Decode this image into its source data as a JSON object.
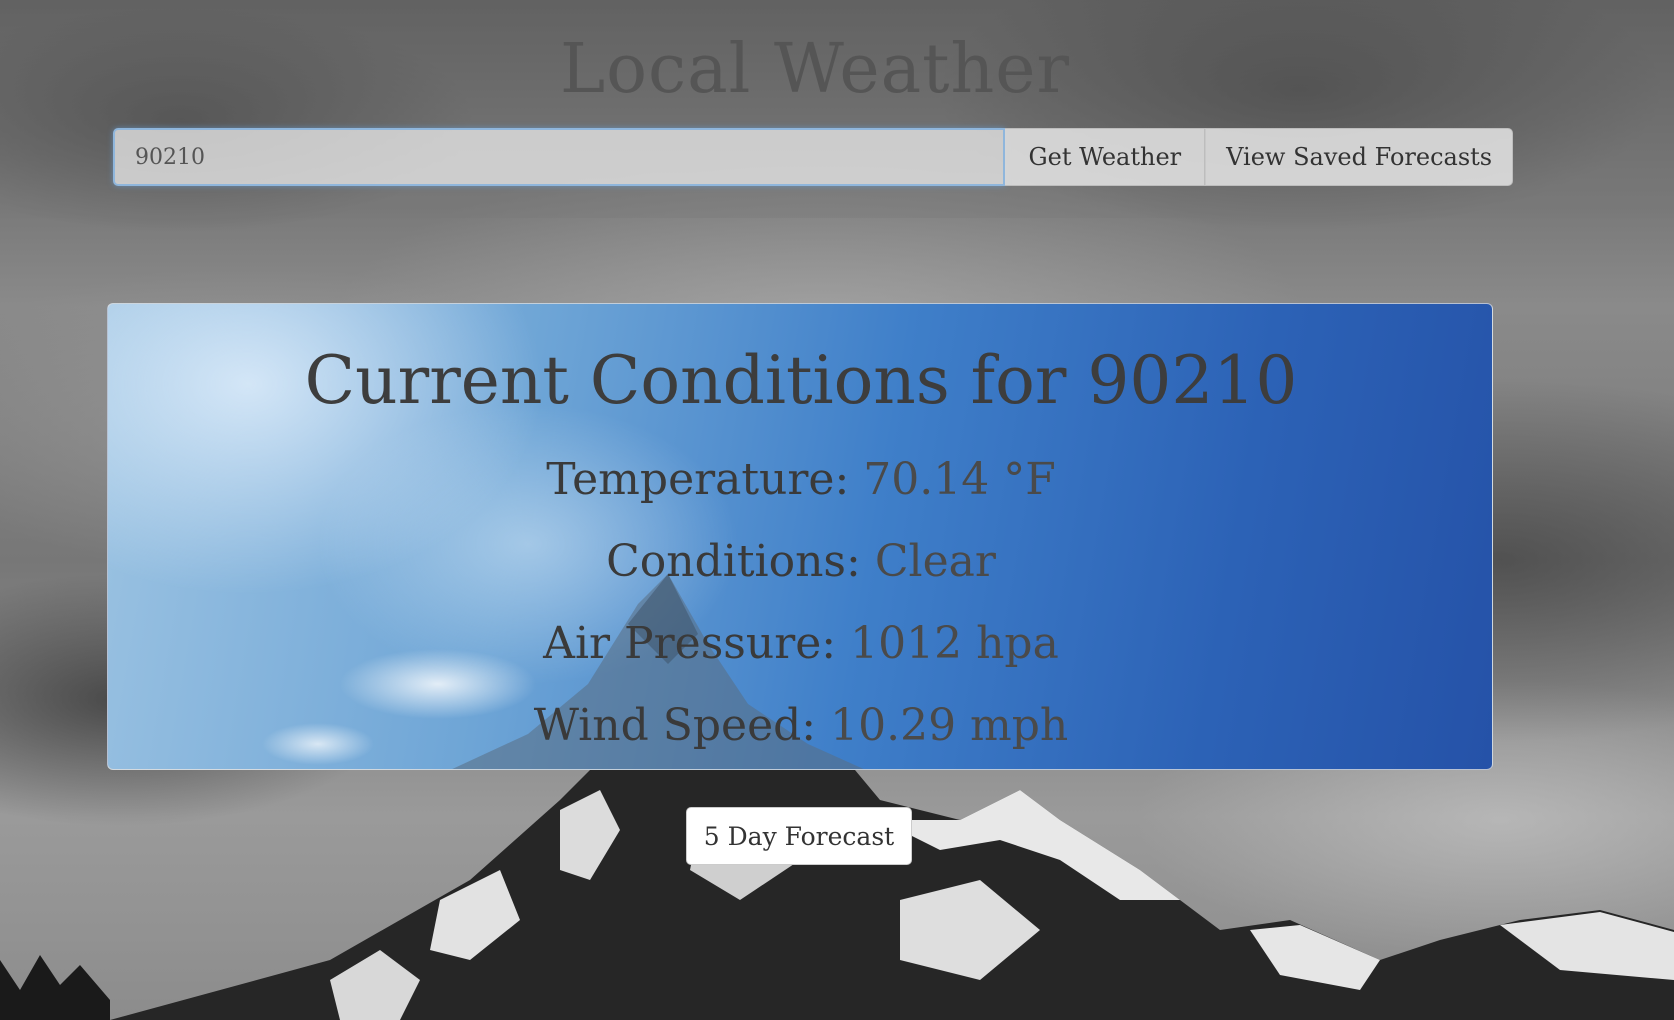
{
  "header": {
    "title": "Local Weather"
  },
  "search": {
    "value": "90210",
    "get_weather_label": "Get Weather",
    "saved_forecasts_label": "View Saved Forecasts"
  },
  "current": {
    "title": "Current Conditions for 90210",
    "temperature_label": "Temperature:",
    "temperature_value": "70.14 °F",
    "conditions_label": "Conditions:",
    "conditions_value": "Clear",
    "pressure_label": "Air Pressure:",
    "pressure_value": "1012 hpa",
    "wind_label": "Wind Speed:",
    "wind_value": "10.29 mph"
  },
  "forecast_button_label": "5 Day Forecast"
}
